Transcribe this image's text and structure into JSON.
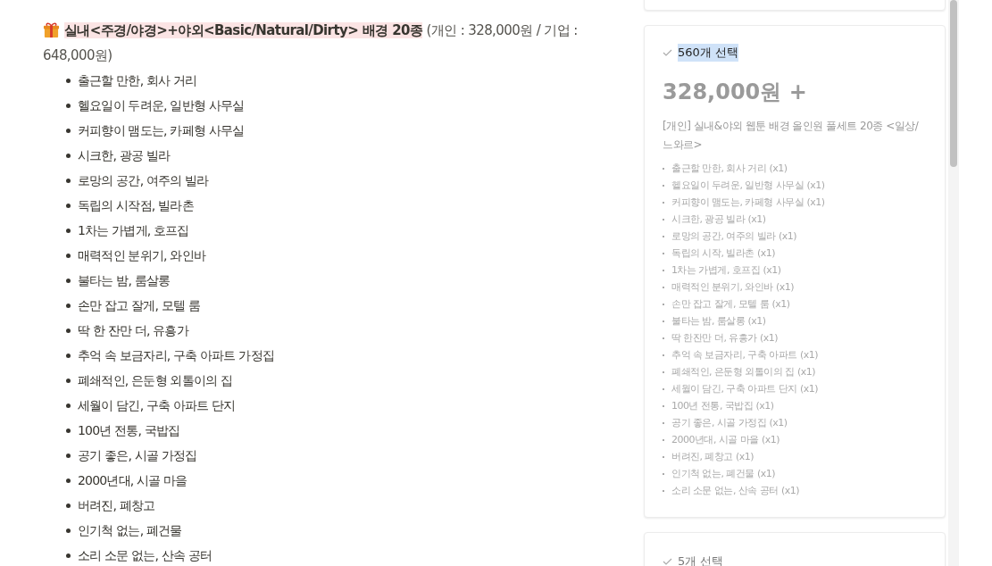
{
  "heading": {
    "highlight": "실내<주경/야경>+야외<Basic/Natural/Dirty> 배경 20종",
    "rest": " (개인 : 328,000원 / 기업 : 648,000원)"
  },
  "items": [
    "출근할 만한, 회사 거리",
    "헬요일이 두려운, 일반형 사무실",
    "커피향이 맴도는, 카페형 사무실",
    "시크한, 광공 빌라",
    "로망의 공간, 여주의 빌라",
    "독립의 시작점, 빌라촌",
    "1차는 가볍게, 호프집",
    "매력적인 분위기, 와인바",
    "불타는 밤, 룸살롱",
    "손만 잡고 잘게, 모텔 룸",
    "딱 한 잔만 더, 유흥가",
    "추억 속 보금자리, 구축 아파트 가정집",
    "폐쇄적인, 은둔형 외톨이의 집",
    "세월이 담긴, 구축 아파트 단지",
    "100년 전통, 국밥집",
    "공기 좋은, 시골 가정집",
    "2000년대, 시골 마을",
    "버려진, 폐창고",
    "인기척 없는, 폐건물",
    "소리 소문 없는, 산속 공터"
  ],
  "cards": [
    {
      "count": "560개 선택",
      "highlighted": true,
      "price": "328,000원 +",
      "product": "[개인] 실내&야외 웹툰 배경 올인원 풀세트 20종 <일상/느와르>",
      "options": [
        "출근할 만한, 회사 거리 (x1)",
        "헬요일이 두려운, 일반형 사무실 (x1)",
        "커피향이 맴도는, 카페형 사무실 (x1)",
        "시크한, 광공 빌라 (x1)",
        "로망의 공간, 여주의 빌라 (x1)",
        "독립의 시작, 빌라촌 (x1)",
        "1차는 가볍게, 호프집 (x1)",
        "매력적인 분위기, 와인바 (x1)",
        "손만 잡고 잘게, 모텔 룸 (x1)",
        "불타는 밤, 룸살롱 (x1)",
        "딱 한잔만 더, 유흥가 (x1)",
        "추억 속 보금자리, 구축 아파트 (x1)",
        "폐쇄적인, 은둔형 외톨이의 집 (x1)",
        "세월이 담긴, 구축 아파트 단지 (x1)",
        "100년 전통, 국밥집 (x1)",
        "공기 좋은, 시골 가정집 (x1)",
        "2000년대, 시골 마을 (x1)",
        "버려진, 폐창고 (x1)",
        "인기척 없는, 폐건물 (x1)",
        "소리 소문 없는, 산속 공터 (x1)"
      ]
    },
    {
      "count": "5개 선택",
      "highlighted": false
    }
  ]
}
